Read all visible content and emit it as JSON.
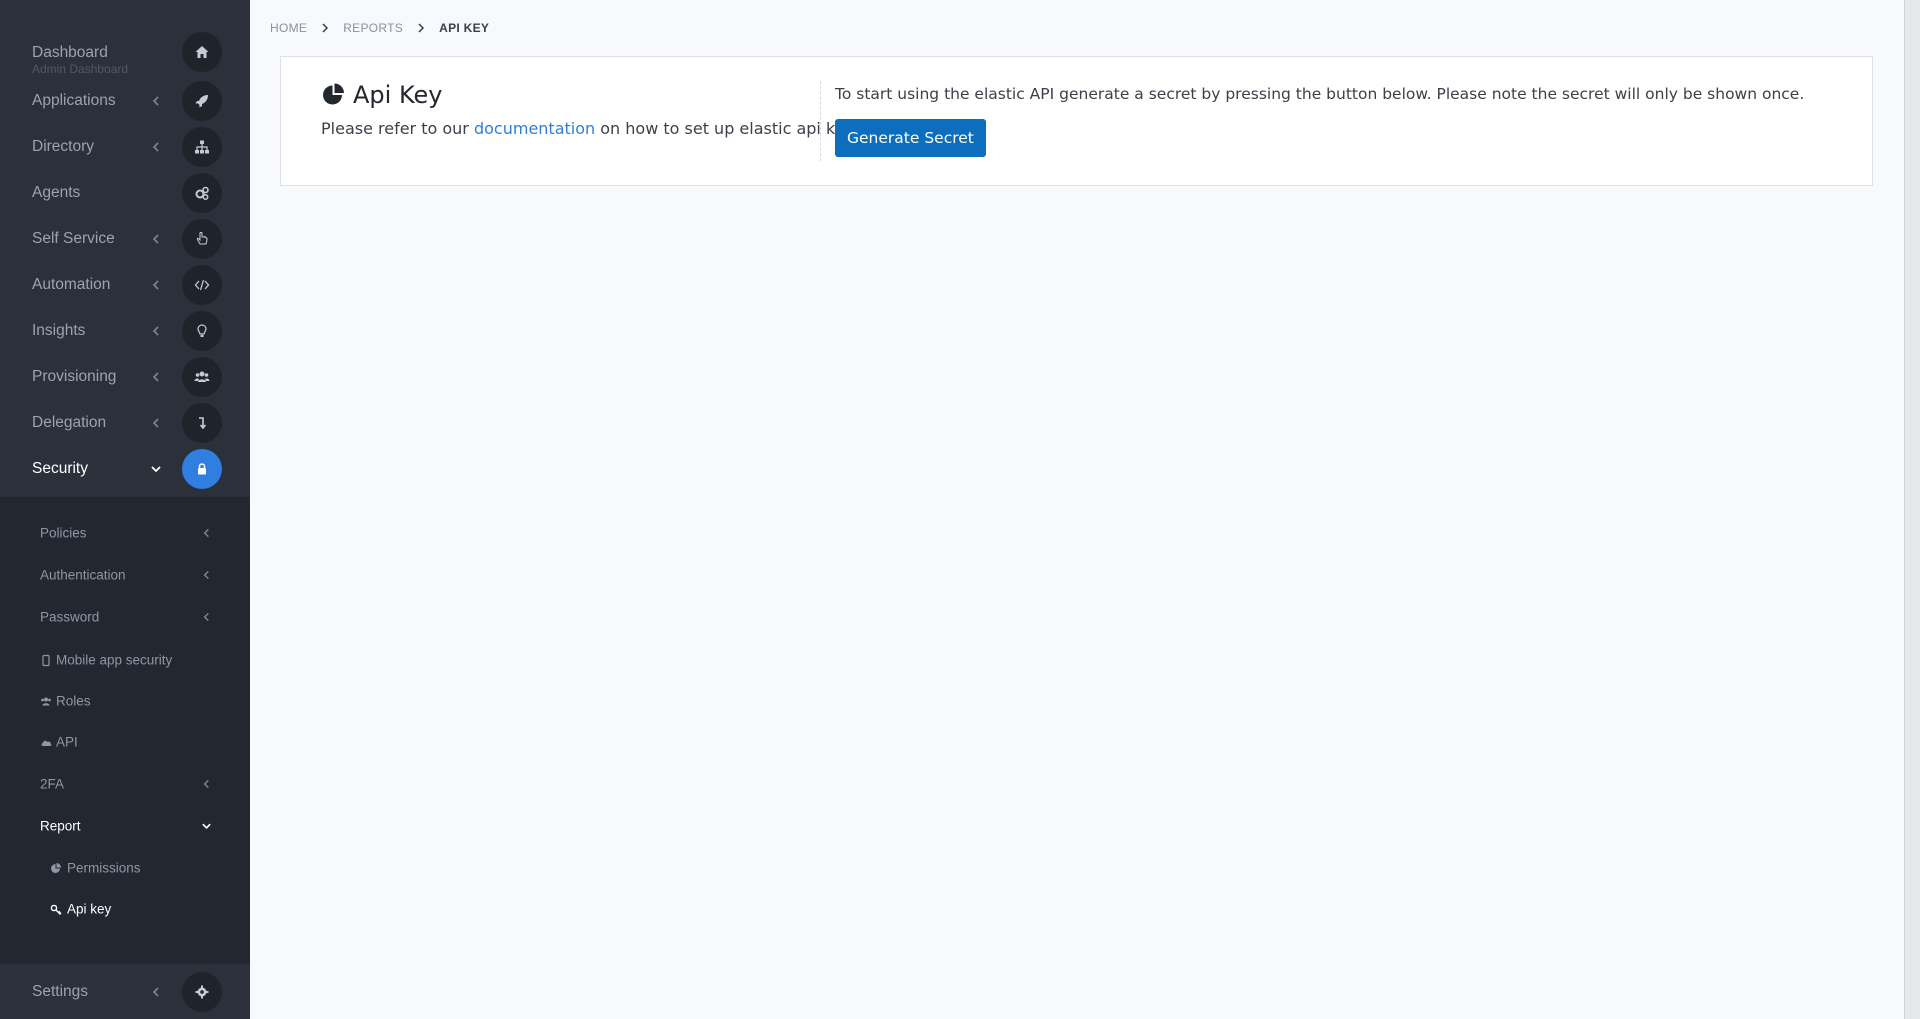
{
  "sidebar": {
    "dashboard": {
      "label": "Dashboard",
      "sublabel": "Admin Dashboard",
      "icon": "home-icon"
    },
    "items": [
      {
        "label": "Applications",
        "icon": "rocket-icon"
      },
      {
        "label": "Directory",
        "icon": "sitemap-icon"
      },
      {
        "label": "Agents",
        "icon": "cogs-icon"
      },
      {
        "label": "Self Service",
        "icon": "hand-pointer-icon"
      },
      {
        "label": "Automation",
        "icon": "code-icon"
      },
      {
        "label": "Insights",
        "icon": "lightbulb-icon"
      },
      {
        "label": "Provisioning",
        "icon": "users-icon"
      },
      {
        "label": "Delegation",
        "icon": "level-down-icon"
      },
      {
        "label": "Security",
        "icon": "lock-icon",
        "expanded": true
      }
    ],
    "security_sub": [
      {
        "label": "Policies"
      },
      {
        "label": "Authentication"
      },
      {
        "label": "Password"
      },
      {
        "label": "Mobile app security",
        "icon": "mobile-icon"
      },
      {
        "label": "Roles",
        "icon": "users-icon"
      },
      {
        "label": "API",
        "icon": "cloud-icon"
      },
      {
        "label": "2FA"
      },
      {
        "label": "Report",
        "expanded": true
      }
    ],
    "report_sub": [
      {
        "label": "Permissions",
        "icon": "pie-chart-icon"
      },
      {
        "label": "Api key",
        "icon": "key-icon",
        "active": true
      }
    ],
    "settings": {
      "label": "Settings",
      "icon": "gear-icon"
    }
  },
  "breadcrumb": [
    "HOME",
    "REPORTS",
    "API KEY"
  ],
  "card": {
    "title": "Api Key",
    "desc_prefix": "Please refer to our ",
    "desc_link": "documentation",
    "desc_suffix": " on how to set up elastic api keys.",
    "right_text": "To start using the elastic API generate a secret by pressing the button below. Please note the secret will only be shown once.",
    "button": "Generate Secret"
  },
  "colors": {
    "sidebar_bg": "#2b303b",
    "active_icon_bg": "#2f7fe0",
    "button_bg": "#0d6ebd",
    "link": "#2f7fd8"
  }
}
